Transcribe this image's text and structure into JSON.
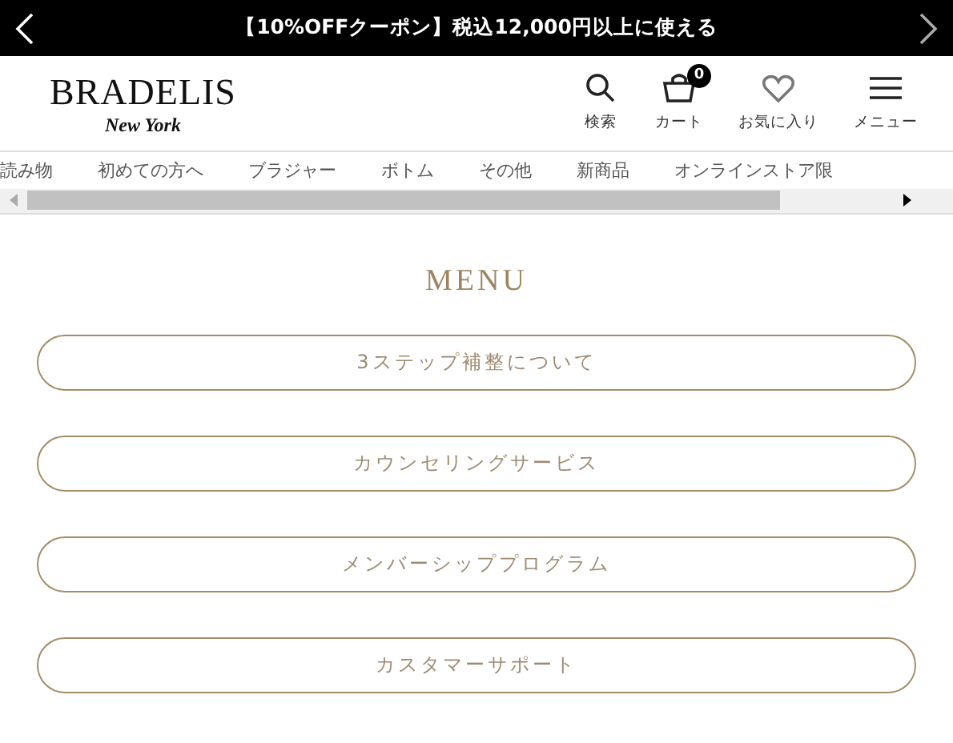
{
  "promo_bar": {
    "text": "【10%OFFクーポン】税込12,000円以上に使える"
  },
  "header": {
    "logo": {
      "name": "BRADELIS",
      "sub": "New York"
    },
    "actions": [
      {
        "kind": "search",
        "label": "検索"
      },
      {
        "kind": "cart",
        "label": "カート",
        "badge": "0"
      },
      {
        "kind": "heart",
        "label": "お気に入り"
      },
      {
        "kind": "menu",
        "label": "メニュー"
      }
    ]
  },
  "category_nav": [
    "読み物",
    "初めての方へ",
    "ブラジャー",
    "ボトム",
    "その他",
    "新商品",
    "オンラインストア限"
  ],
  "menu": {
    "title": "MENU",
    "items": [
      "3ステップ補整について",
      "カウンセリングサービス",
      "メンバーシッププログラム",
      "カスタマーサポート"
    ]
  }
}
